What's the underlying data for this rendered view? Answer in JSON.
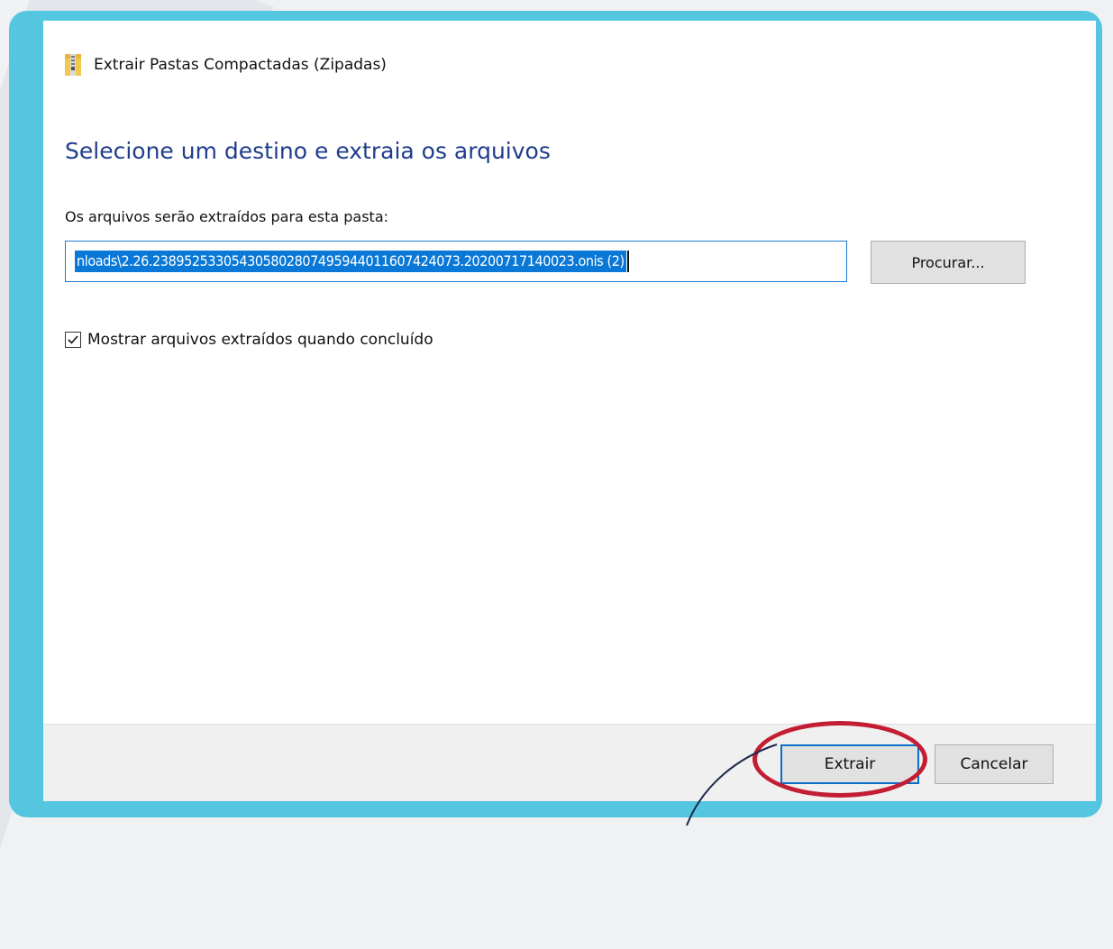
{
  "dialog": {
    "title": "Extrair Pastas Compactadas (Zipadas)",
    "heading": "Selecione um destino e extraia os arquivos",
    "destination_label": "Os arquivos serão extraídos para esta pasta:",
    "destination_value": "nloads\\2.26.238952533054305802807495944011607424073.20200717140023.onis (2)",
    "browse_label": "Procurar...",
    "show_files_label": "Mostrar arquivos extraídos quando concluído",
    "show_files_checked": true,
    "extract_label": "Extrair",
    "cancel_label": "Cancelar"
  },
  "icons": {
    "title_icon": "zip-folder-icon",
    "checkbox_mark": "checkmark-icon"
  },
  "colors": {
    "frame": "#55c6e0",
    "heading": "#1f3d8c",
    "selection": "#0a78d7",
    "highlight": "#c21d33",
    "default_button_border": "#0b6ec9"
  }
}
